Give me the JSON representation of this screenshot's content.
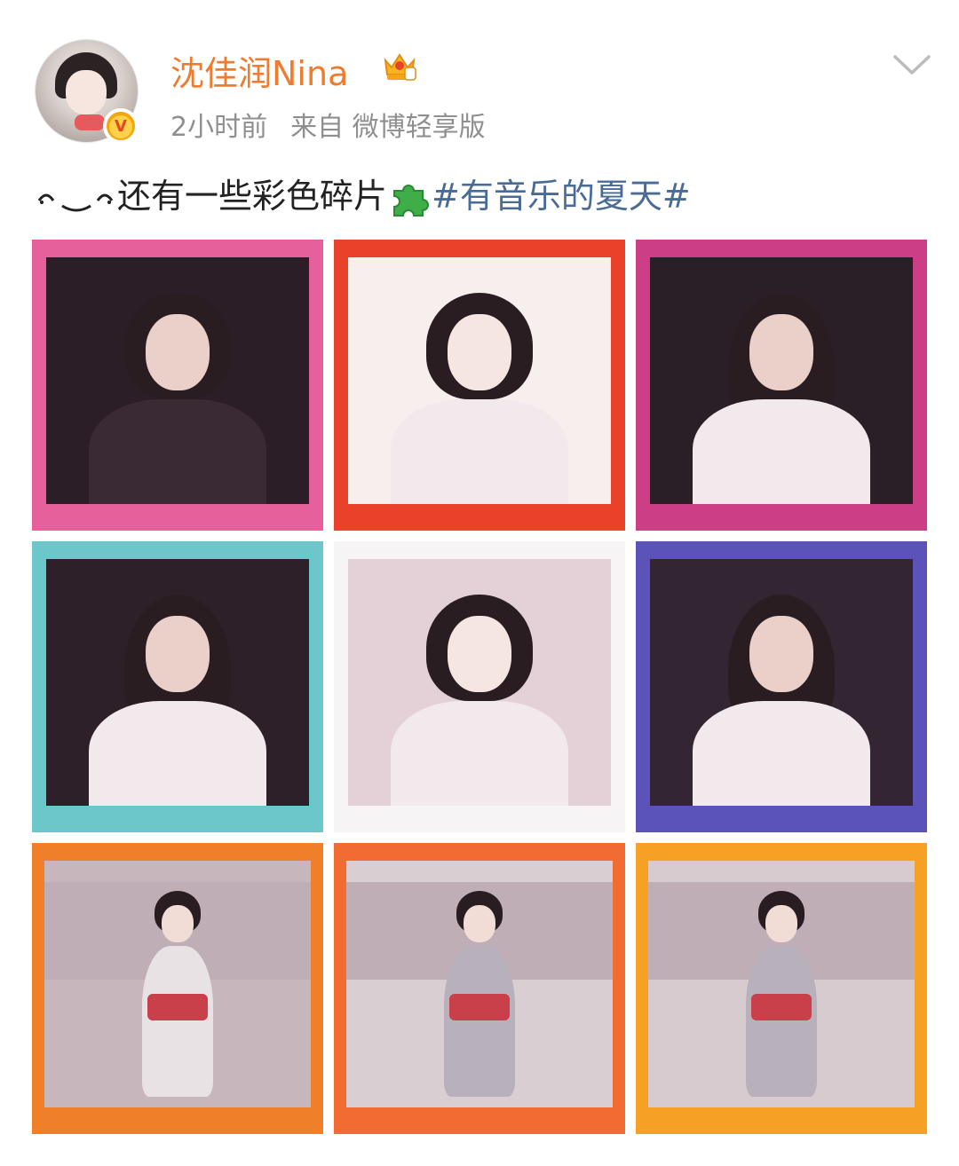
{
  "post": {
    "author_name": "沈佳润Nina",
    "time": "2小时前",
    "source": "来自 微博轻享版",
    "text": "还有一些彩色碎片",
    "hashtag": "#有音乐的夏天#"
  },
  "icons": {
    "avatar": "profile-photo",
    "verified": "verified-v-badge",
    "vip": "crown-badge",
    "menu": "chevron-down-icon",
    "emoji_smile": "smile-emoticon",
    "emoji_puzzle": "puzzle-piece-emoji"
  },
  "colors": {
    "author": "#ee7b2f",
    "hashtag": "#4a6b96",
    "meta": "#8f8f8f"
  },
  "photos": [
    {
      "frame_color": "#e6609b",
      "background": "#2c1e26",
      "figure": "dark-dress"
    },
    {
      "frame_color": "#e8432a",
      "background": "#f6efee",
      "figure": "white-blouse"
    },
    {
      "frame_color": "#cc3f86",
      "background": "#2a1e27",
      "figure": "white-dress"
    },
    {
      "frame_color": "#6cc7cb",
      "background": "#2e2028",
      "figure": "white-dress"
    },
    {
      "frame_color": "#f7f4f5",
      "background": "#e3d1d7",
      "figure": "white-blouse"
    },
    {
      "frame_color": "#5b53b8",
      "background": "#342532",
      "figure": "white-dress"
    },
    {
      "frame_color": "#f07f2a",
      "background": "#c8b6bd",
      "figure": "rooftop-red"
    },
    {
      "frame_color": "#f26b32",
      "background": "#d9cfd3",
      "figure": "rooftop-bass"
    },
    {
      "frame_color": "#f6a124",
      "background": "#d8cbd0",
      "figure": "rooftop-guitar"
    }
  ]
}
